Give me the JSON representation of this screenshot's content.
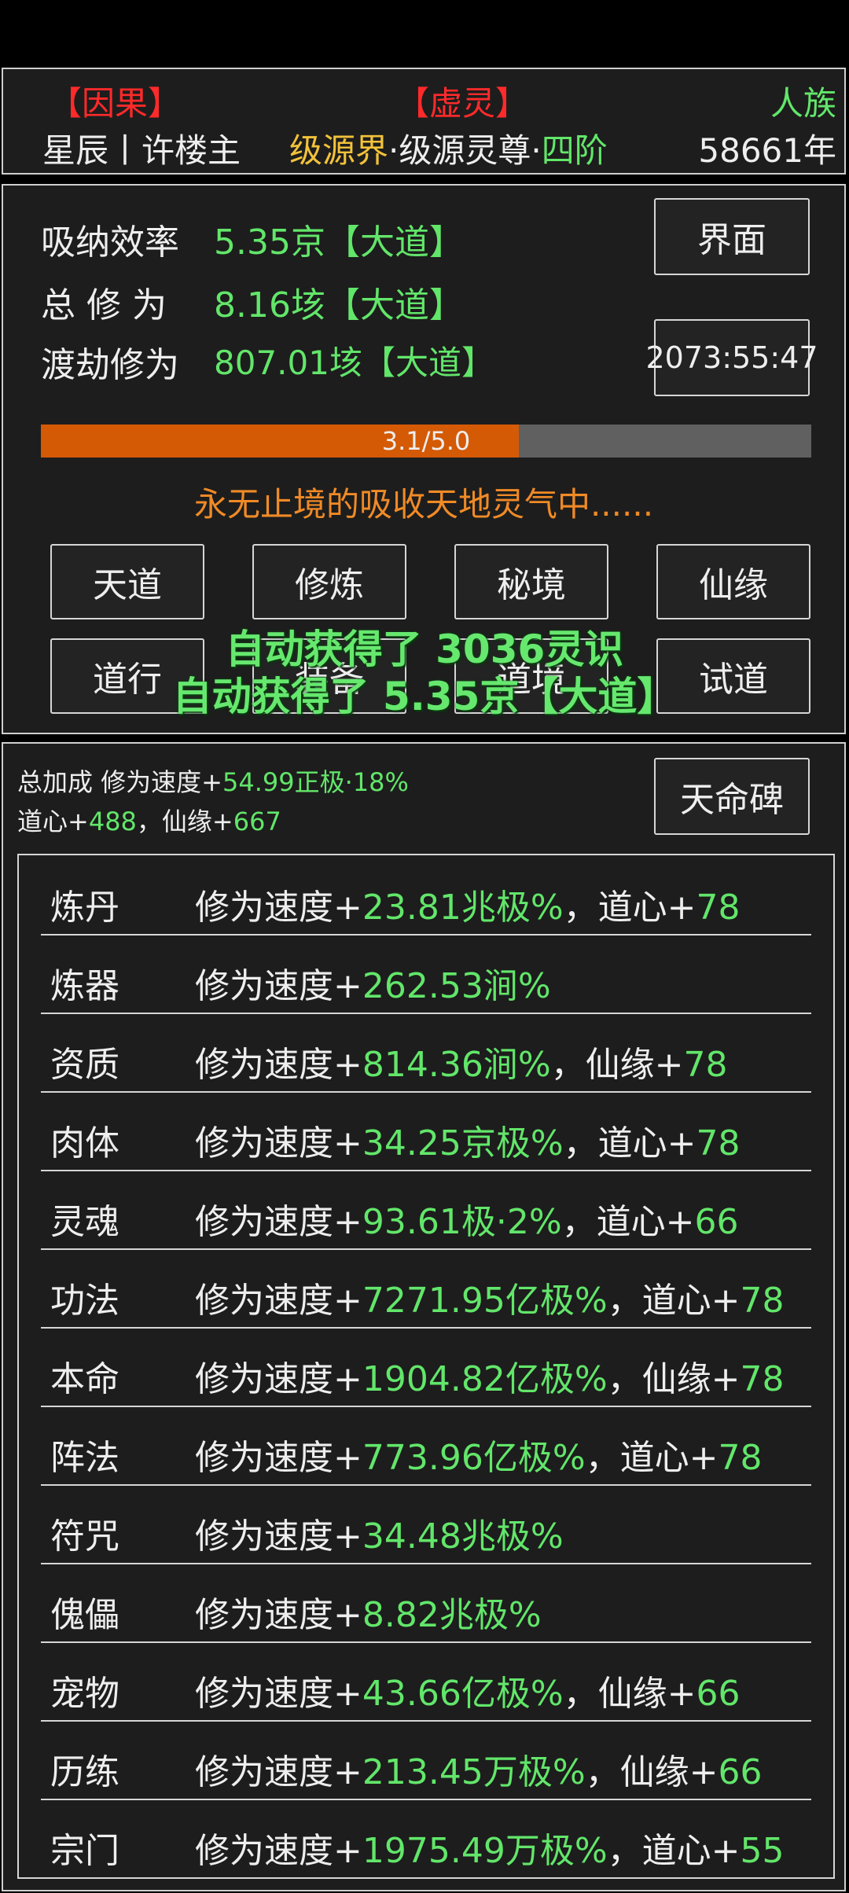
{
  "header": {
    "tag_left": "【因果】",
    "tag_center": "【虚灵】",
    "tag_right": "人族",
    "identity": "星辰丨许楼主",
    "realm_part1": "级源界",
    "realm_part2": "·级源灵尊·",
    "realm_part3": "四阶",
    "years": "58661年"
  },
  "stats": {
    "absorb_label": "吸纳效率",
    "absorb_value": "5.35京【大道】",
    "total_label": "总 修 为",
    "total_value": "8.16垓【大道】",
    "tribulation_label": "渡劫修为",
    "tribulation_value": "807.01垓【大道】",
    "interface_button": "界面",
    "timer": "2073:55:47",
    "progress_text": "3.1/5.0",
    "progress_fraction": 0.62,
    "status_message": "永无止境的吸收天地灵气中......"
  },
  "actions": [
    "天道",
    "修炼",
    "秘境",
    "仙缘",
    "道行",
    "装备",
    "道境",
    "试道"
  ],
  "toasts": [
    "自动获得了 3036灵识",
    "自动获得了 5.35京【大道】"
  ],
  "bonus": {
    "total_prefix": "总加成 修为速度+",
    "total_value": "54.99正极·18%",
    "daoxin_prefix": "道心+",
    "daoxin_value": "488",
    "sep": "，",
    "xianyuan_prefix": "仙缘+",
    "xianyuan_value": "667",
    "stele_button": "天命碑"
  },
  "rows": [
    {
      "cat": "炼丹",
      "prefix": "修为速度+",
      "value": "23.81兆极%",
      "extra_label": "，道心+",
      "extra_value": "78"
    },
    {
      "cat": "炼器",
      "prefix": "修为速度+",
      "value": "262.53涧%",
      "extra_label": "",
      "extra_value": ""
    },
    {
      "cat": "资质",
      "prefix": "修为速度+",
      "value": "814.36涧%",
      "extra_label": "，仙缘+",
      "extra_value": "78"
    },
    {
      "cat": "肉体",
      "prefix": "修为速度+",
      "value": "34.25京极%",
      "extra_label": "，道心+",
      "extra_value": "78"
    },
    {
      "cat": "灵魂",
      "prefix": "修为速度+",
      "value": "93.61极·2%",
      "extra_label": "，道心+",
      "extra_value": "66"
    },
    {
      "cat": "功法",
      "prefix": "修为速度+",
      "value": "7271.95亿极%",
      "extra_label": "，道心+",
      "extra_value": "78"
    },
    {
      "cat": "本命",
      "prefix": "修为速度+",
      "value": "1904.82亿极%",
      "extra_label": "，仙缘+",
      "extra_value": "78"
    },
    {
      "cat": "阵法",
      "prefix": "修为速度+",
      "value": "773.96亿极%",
      "extra_label": "，道心+",
      "extra_value": "78"
    },
    {
      "cat": "符咒",
      "prefix": "修为速度+",
      "value": "34.48兆极%",
      "extra_label": "",
      "extra_value": ""
    },
    {
      "cat": "傀儡",
      "prefix": "修为速度+",
      "value": "8.82兆极%",
      "extra_label": "",
      "extra_value": ""
    },
    {
      "cat": "宠物",
      "prefix": "修为速度+",
      "value": "43.66亿极%",
      "extra_label": "，仙缘+",
      "extra_value": "66"
    },
    {
      "cat": "历练",
      "prefix": "修为速度+",
      "value": "213.45万极%",
      "extra_label": "，仙缘+",
      "extra_value": "66"
    },
    {
      "cat": "宗门",
      "prefix": "修为速度+",
      "value": "1975.49万极%",
      "extra_label": "，道心+",
      "extra_value": "55"
    }
  ],
  "colors": {
    "accent_green": "#62e66a",
    "accent_red": "#ff2a2a",
    "accent_yellow": "#f2c23a",
    "accent_orange": "#f08a26",
    "progress_fill": "#d45a06",
    "progress_track": "#606060"
  }
}
